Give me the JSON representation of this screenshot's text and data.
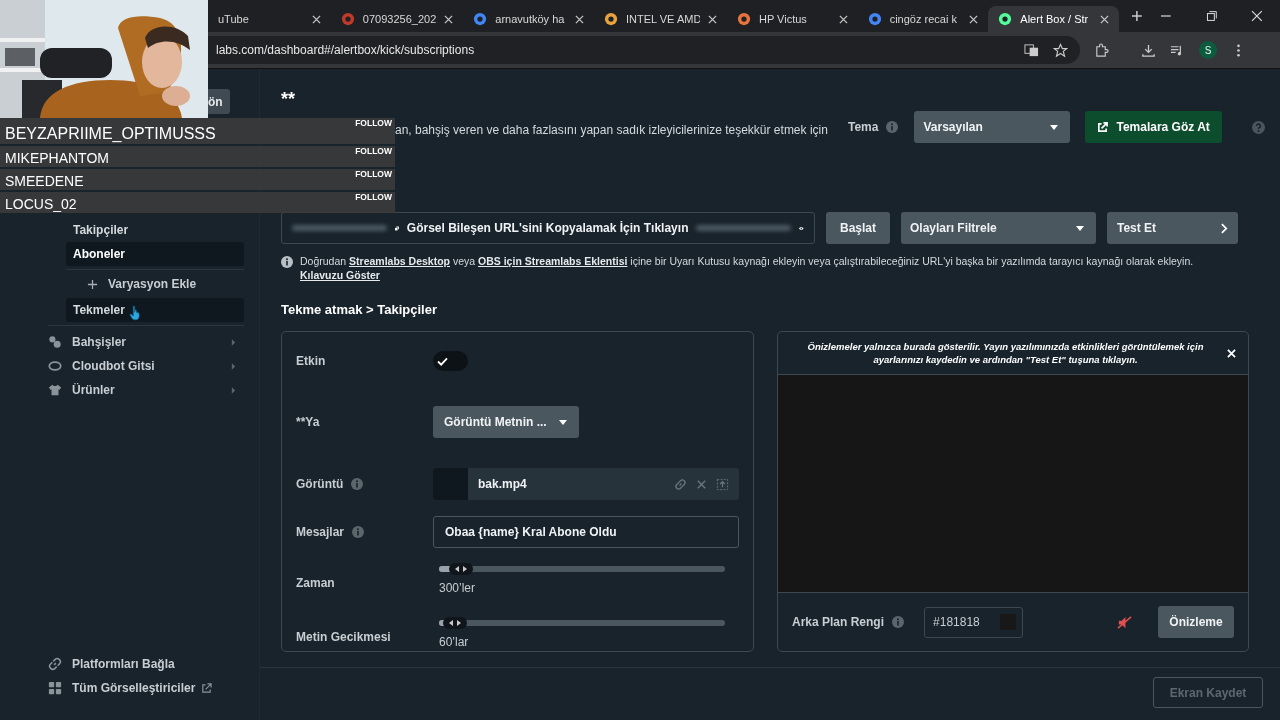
{
  "browser": {
    "tabs": [
      {
        "title": "uTube",
        "selected": false
      },
      {
        "title": "07093256_202",
        "selected": false
      },
      {
        "title": "arnavutköy ha",
        "selected": false
      },
      {
        "title": "INTEL VE AMD",
        "selected": false
      },
      {
        "title": "HP Victus",
        "selected": false
      },
      {
        "title": "cingöz recai k",
        "selected": false
      },
      {
        "title": "Alert Box / Str",
        "selected": true
      }
    ],
    "url": "labs.com/dashboard#/alertbox/kick/subscriptions",
    "profile_initial": "S"
  },
  "follow_overlay": [
    {
      "name": "BEYZAPRIIME_OPTIMUSSS",
      "action": "FOLLOW"
    },
    {
      "name": "MIKEPHANTOM",
      "action": "FOLLOW"
    },
    {
      "name": "SMEEDENE",
      "action": "FOLLOW"
    },
    {
      "name": "LOCUS_02",
      "action": "FOLLOW"
    }
  ],
  "sidebar": {
    "top_button": "ön",
    "sub_items": [
      {
        "kind": "item",
        "label": "Takipçiler",
        "selected": false,
        "hovered": false
      },
      {
        "kind": "item",
        "label": "Aboneler",
        "selected": true,
        "hovered": false
      },
      {
        "kind": "add",
        "label": "Varyasyon Ekle",
        "selected": false,
        "hovered": false
      },
      {
        "kind": "item",
        "label": "Tekmeler",
        "selected": false,
        "hovered": true
      }
    ],
    "sections": [
      "Bahşişler",
      "Cloudbot Gitsi",
      "Ürünler"
    ],
    "footer": [
      "Platformları Bağla",
      "Tüm Görselleştiriciler"
    ]
  },
  "main": {
    "heading": "**",
    "description": "an, bahşiş veren ve daha fazlasını yapan sadık izleyicilerinize teşekkür etmek için",
    "theme": {
      "label": "Tema",
      "value": "Varsayılan",
      "browse_button": "Temalara Göz At"
    },
    "widget_url": {
      "copy_text": "Görsel Bileşen URL'sini Kopyalamak İçin Tıklayın",
      "start_button": "Başlat",
      "filter": "Olayları Filtrele",
      "test_button": "Test Et"
    },
    "info": {
      "texts": [
        "Doğrudan ",
        " veya ",
        " içine bir Uyarı Kutusu kaynağı ekleyin veya çalıştırabileceğiniz URL'yi başka bir yazılımda tarayıcı kaynağı olarak ekleyin. "
      ],
      "links": [
        "Streamlabs Desktop",
        "OBS için Streamlabs Eklentisi",
        "Kılavuzu Göster"
      ]
    },
    "breadcrumb": "Tekme atmak > Takipçiler",
    "settings": [
      {
        "kind": "toggle",
        "label": "Etkin",
        "info": false,
        "on": true
      },
      {
        "kind": "select",
        "label": "**Ya",
        "info": false,
        "value": "Görüntü Metnin ..."
      },
      {
        "kind": "file",
        "label": "Görüntü",
        "info": true,
        "value": "bak.mp4"
      },
      {
        "kind": "text",
        "label": "Mesajlar",
        "info": true,
        "value": "Obaa {name} Kral Abone Oldu"
      },
      {
        "kind": "slider",
        "label": "Zaman",
        "info": false,
        "level": 0.07,
        "reading": "300’ler"
      },
      {
        "kind": "slider",
        "label": "Metin Gecikmesi",
        "info": false,
        "level": 0.05,
        "reading": "60’lar"
      }
    ],
    "preview": {
      "notice": "Önizlemeler yalnızca burada gösterilir. Yayın yazılımınızda etkinlikleri görüntülemek için ayarlarınızı kaydedin ve ardından \"Test Et\" tuşuna tıklayın.",
      "background_label": "Arka Plan Rengi",
      "background_value": "#181818",
      "muted": true,
      "preview_button": "Önizleme"
    },
    "save_button": {
      "label": "Ekran Kaydet",
      "disabled": true
    }
  }
}
